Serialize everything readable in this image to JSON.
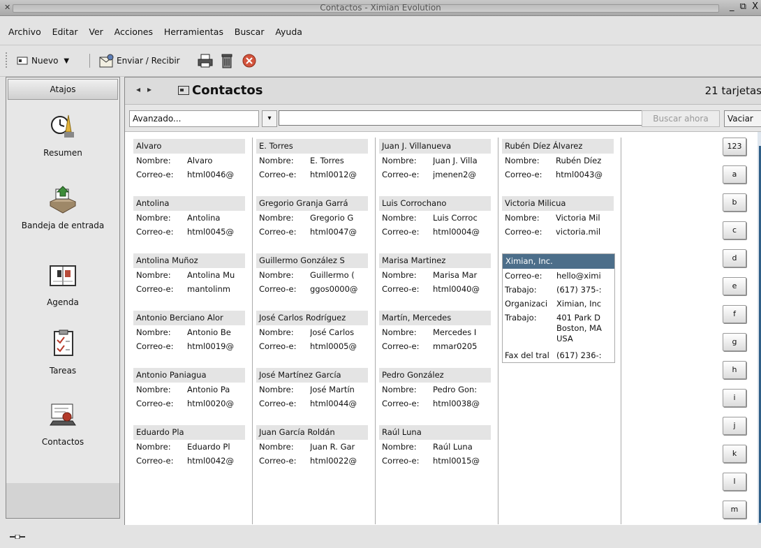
{
  "window": {
    "title": "Contactos - Ximian Evolution",
    "controls": "_ ⧉ X"
  },
  "menu": {
    "items": [
      "Archivo",
      "Editar",
      "Ver",
      "Acciones",
      "Herramientas",
      "Buscar",
      "Ayuda"
    ]
  },
  "toolbar": {
    "new_label": "Nuevo",
    "send_receive_label": "Enviar / Recibir",
    "print_icon": "printer-icon",
    "delete_icon": "trash-icon",
    "stop_icon": "stop-icon"
  },
  "sidebar": {
    "header": "Atajos",
    "items": [
      {
        "label": "Resumen",
        "icon": "summary-icon"
      },
      {
        "label": "Bandeja de entrada",
        "icon": "inbox-icon"
      },
      {
        "label": "Agenda",
        "icon": "calendar-icon"
      },
      {
        "label": "Tareas",
        "icon": "tasks-icon"
      },
      {
        "label": "Contactos",
        "icon": "contacts-icon"
      }
    ]
  },
  "header": {
    "title": "Contactos",
    "count": "21 tarjetas"
  },
  "search": {
    "mode": "Avanzado...",
    "value": "",
    "search_now": "Buscar ahora",
    "clear": "Vaciar"
  },
  "labels": {
    "name": "Nombre:",
    "email": "Correo-e:",
    "work": "Trabajo:",
    "org": "Organizaci",
    "work_addr": "Trabajo:",
    "fax": "Fax del tral"
  },
  "columns": [
    [
      {
        "title": "Alvaro",
        "name": "Alvaro",
        "email": "html0046@"
      },
      {
        "title": "Antolina",
        "name": "Antolina",
        "email": "html0045@"
      },
      {
        "title": "Antolina Muñoz",
        "name": "Antolina Mu",
        "email": "mantolinm"
      },
      {
        "title": "Antonio Berciano Alor",
        "name": "Antonio Be",
        "email": "html0019@"
      },
      {
        "title": "Antonio Paniagua",
        "name": "Antonio Pa",
        "email": "html0020@"
      },
      {
        "title": "Eduardo Pla",
        "name": "Eduardo Pl",
        "email": "html0042@"
      }
    ],
    [
      {
        "title": "E. Torres",
        "name": "E. Torres",
        "email": "html0012@"
      },
      {
        "title": "Gregorio Granja Garrá",
        "name": "Gregorio G",
        "email": "html0047@"
      },
      {
        "title": "Guillermo González S",
        "name": "Guillermo (",
        "email": "ggos0000@"
      },
      {
        "title": "José Carlos Rodríguez",
        "name": "José Carlos",
        "email": "html0005@"
      },
      {
        "title": "José Martínez García",
        "name": "José Martín",
        "email": "html0044@"
      },
      {
        "title": "Juan García Roldán",
        "name": "Juan R. Gar",
        "email": "html0022@"
      }
    ],
    [
      {
        "title": "Juan J. Villanueva",
        "name": "Juan J. Villa",
        "email": "jmenen2@"
      },
      {
        "title": "Luis Corrochano",
        "name": "Luis Corroc",
        "email": "html0004@"
      },
      {
        "title": "Marisa Martinez",
        "name": "Marisa Mar",
        "email": "html0040@"
      },
      {
        "title": "Martín, Mercedes",
        "name": "Mercedes I",
        "email": "mmar0205"
      },
      {
        "title": "Pedro González",
        "name": "Pedro Gon:",
        "email": "html0038@"
      },
      {
        "title": "Raúl Luna",
        "name": "Raúl Luna",
        "email": "html0015@"
      }
    ],
    [
      {
        "title": "Rubén Díez Álvarez",
        "name": "Rubén Díez",
        "email": "html0043@"
      },
      {
        "title": "Victoria Milicua",
        "name": "Victoria Mil",
        "email": "victoria.mil"
      }
    ]
  ],
  "selected_card": {
    "title": "Ximian, Inc.",
    "email": "hello@ximi",
    "work_phone": "(617) 375-:",
    "org": "Ximian, Inc",
    "addr1": "401 Park D",
    "addr2": "Boston, MA",
    "addr3": "USA",
    "fax": "(617) 236-:"
  },
  "letters": [
    "123",
    "a",
    "b",
    "c",
    "d",
    "e",
    "f",
    "g",
    "h",
    "i",
    "j",
    "k",
    "l",
    "m"
  ],
  "colors": {
    "selected_header": "#4c6e8a",
    "scroll_accent": "#2f5f87"
  }
}
